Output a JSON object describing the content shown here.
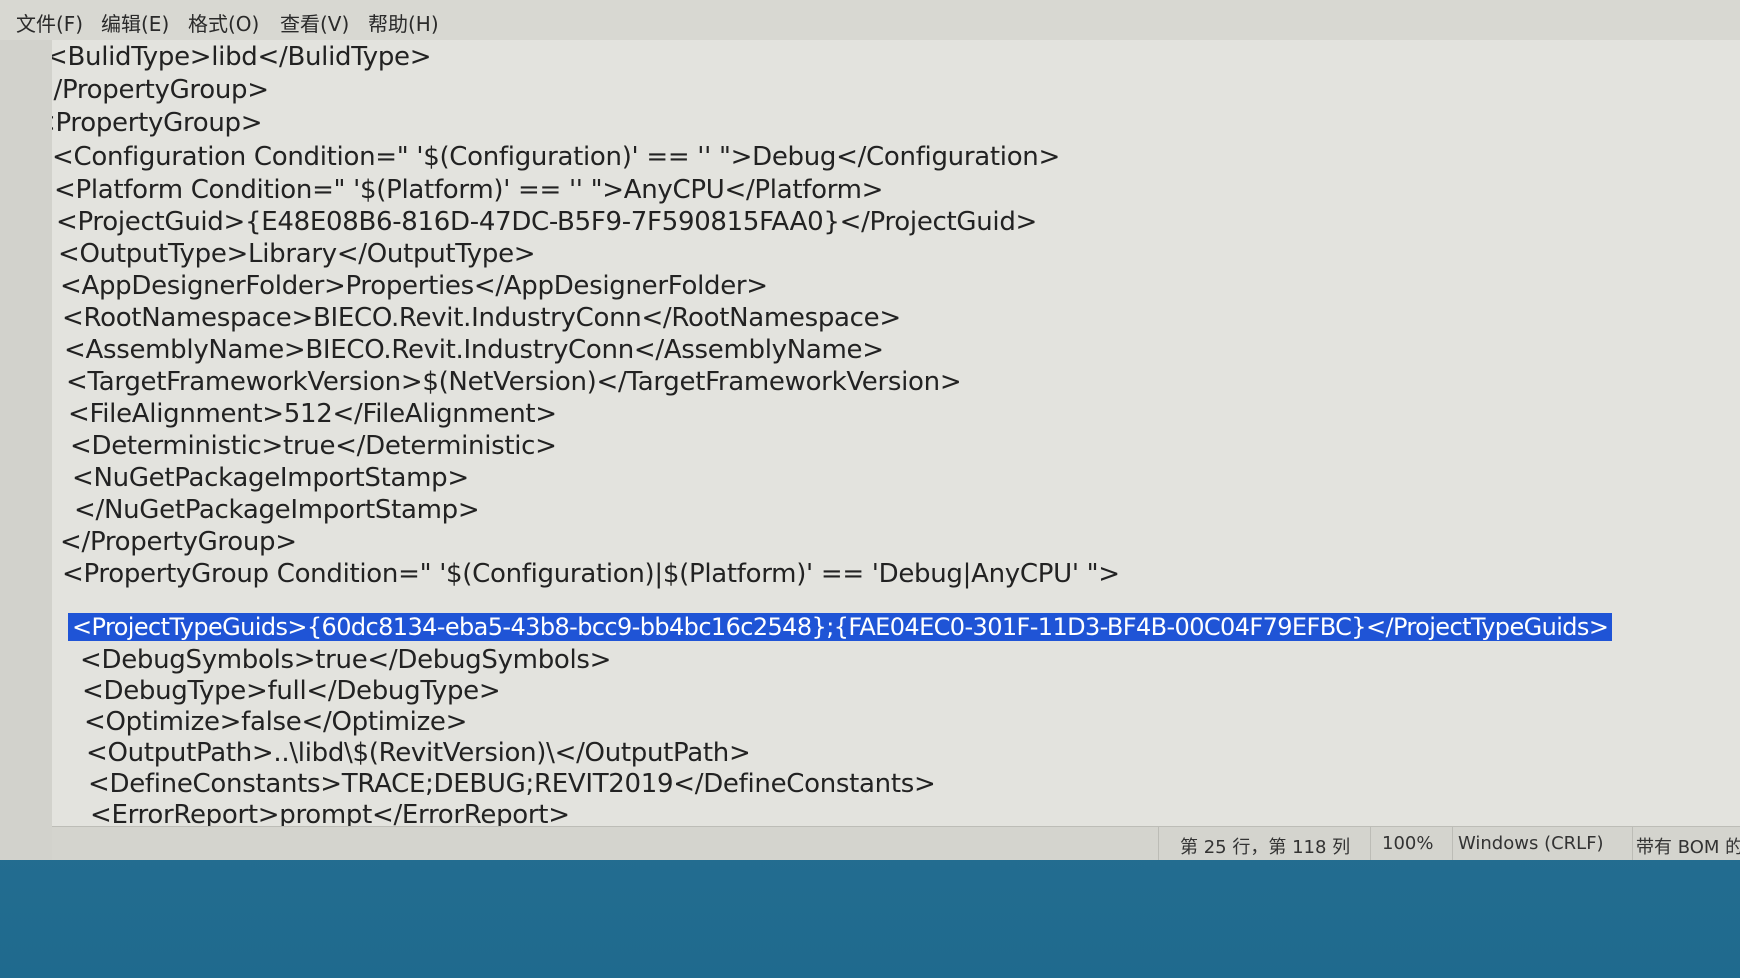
{
  "menu": {
    "items": [
      "文件(F)",
      "编辑(E)",
      "格式(O)",
      "查看(V)",
      "帮助(H)"
    ]
  },
  "editor": {
    "lines": [
      "<BulidType>libd</BulidType>",
      "</PropertyGroup>",
      "<PropertyGroup>",
      "<Configuration Condition=\" '$(Configuration)' == '' \">Debug</Configuration>",
      "<Platform Condition=\" '$(Platform)' == '' \">AnyCPU</Platform>",
      "<ProjectGuid>{E48E08B6-816D-47DC-B5F9-7F590815FAA0}</ProjectGuid>",
      "<OutputType>Library</OutputType>",
      "<AppDesignerFolder>Properties</AppDesignerFolder>",
      "<RootNamespace>BIECO.Revit.IndustryConn</RootNamespace>",
      "<AssemblyName>BIECO.Revit.IndustryConn</AssemblyName>",
      "<TargetFrameworkVersion>$(NetVersion)</TargetFrameworkVersion>",
      "<FileAlignment>512</FileAlignment>",
      "<Deterministic>true</Deterministic>",
      "<NuGetPackageImportStamp>",
      "</NuGetPackageImportStamp>",
      "</PropertyGroup>",
      "<PropertyGroup Condition=\" '$(Configuration)|$(Platform)' == 'Debug|AnyCPU' \">",
      "<ProjectTypeGuids>{60dc8134-eba5-43b8-bcc9-bb4bc16c2548};{FAE04EC0-301F-11D3-BF4B-00C04F79EFBC}</ProjectTypeGuids>",
      "<DebugSymbols>true</DebugSymbols>",
      "<DebugType>full</DebugType>",
      "<Optimize>false</Optimize>",
      "<OutputPath>..\\libd\\$(RevitVersion)\\</OutputPath>",
      "<DefineConstants>TRACE;DEBUG;REVIT2019</DefineConstants>",
      "<ErrorReport>prompt</ErrorReport>"
    ]
  },
  "status": {
    "position": "第 25 行，第 118 列",
    "zoom": "100%",
    "line_ending": "Windows (CRLF)",
    "encoding": "带有 BOM 的"
  },
  "colors": {
    "selection": "#1f54d6",
    "editor_bg": "#e3e3de",
    "desktop": "#2f7596"
  }
}
